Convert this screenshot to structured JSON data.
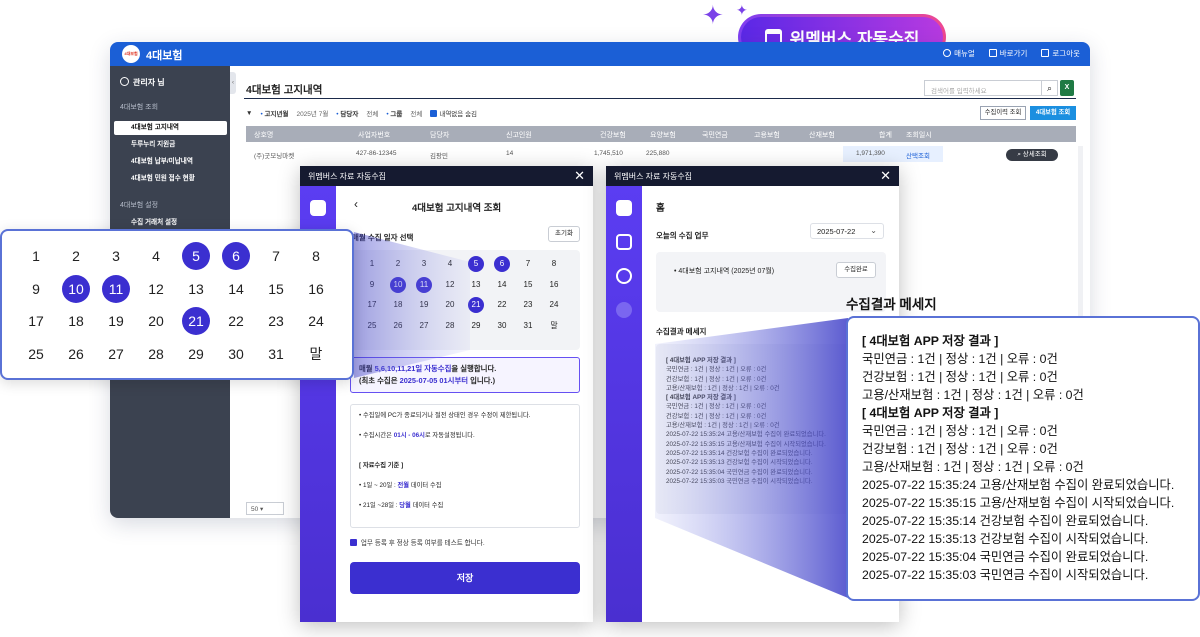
{
  "pill": {
    "label": "위멤버스 자동수집",
    "icon": "calendar-icon"
  },
  "app": {
    "title": "4대보험",
    "logo": "4대보험",
    "topbar": {
      "manual": "매뉴얼",
      "shortcut": "바로가기",
      "logout": "로그아웃"
    },
    "sidebar": {
      "user": "관리자 님",
      "section1": "4대보험 조회",
      "items": [
        "4대보험 고지내역",
        "두루누리 지원금",
        "4대보험 납부/미납내역",
        "4대보험 민원 접수 현황"
      ],
      "section2": "4대보험 설정",
      "item_setting": "수집 거래처 설정"
    },
    "page_title": "4대보험 고지내역",
    "search_placeholder": "검색어를 입력하세요",
    "excel": "X",
    "filter": {
      "notice_month_label": "고지년월",
      "notice_month_value": "2025년 7월",
      "manager_label": "담당자",
      "manager_value": "전체",
      "group_label": "그룹",
      "group_value": "전체",
      "hide_label": "내역없음 숨김"
    },
    "buttons": {
      "history": "수집이력 조회",
      "view": "4대보험 조회",
      "detail": "상세조회"
    },
    "columns": [
      "상호명",
      "사업자번호",
      "담당자",
      "신고인원",
      "건강보험",
      "요양보험",
      "국민연금",
      "고용보험",
      "산재보험",
      "합계",
      "조회일시"
    ],
    "row": {
      "company": "(주)굿모닝마켓",
      "bizno": "427-86-12345",
      "manager": "김팡민",
      "count": "14",
      "health": "1,745,510",
      "care": "225,880",
      "total": "1,971,390",
      "status": "산택조회"
    },
    "pager": "50"
  },
  "dialog1": {
    "bar_title": "위멤버스 자료 자동수집",
    "title": "4대보험 고지내역 조회",
    "date_label": "매월 수집 일자 선택",
    "reset": "초기화",
    "calendar": [
      "1",
      "2",
      "3",
      "4",
      "5",
      "6",
      "7",
      "8",
      "9",
      "10",
      "11",
      "12",
      "13",
      "14",
      "15",
      "16",
      "17",
      "18",
      "19",
      "20",
      "21",
      "22",
      "23",
      "24",
      "25",
      "26",
      "27",
      "28",
      "29",
      "30",
      "31",
      "말"
    ],
    "selected": [
      "5",
      "6",
      "10",
      "11",
      "21"
    ],
    "info_line1_a": "매월 ",
    "info_line1_b": "5,6,10,11,21일 자동수집",
    "info_line1_c": "을 실행합니다.",
    "info_line2_a": "(최초 수집은 ",
    "info_line2_b": "2025-07-05 01시부터",
    "info_line2_c": " 입니다.)",
    "note1": "수집일에 PC가 종료되거나 절전 상태인 경우 수정이 제한됩니다.",
    "note2_a": "수집시간은 ",
    "note2_b": "01시 - 06시",
    "note2_c": "로 자동설정됩니다.",
    "note_head": "[ 자료수집 기준 ]",
    "note3_a": "1일 ~ 20일 : ",
    "note3_b": "전월",
    "note3_c": " 데이터 수집",
    "note4_a": "21일 ~28일 : ",
    "note4_b": "당월",
    "note4_c": " 데이터 수집",
    "check_label": "업무 등록 후 정상 등록 여부를 테스트 합니다.",
    "save": "저장"
  },
  "dialog2": {
    "bar_title": "위멤버스 자료 자동수집",
    "home": "홈",
    "task_label": "오늘의 수집 업무",
    "date": "2025-07-22",
    "task_item": "4대보험 고지내역  (2025년 07월)",
    "done": "수집완료",
    "msg_label": "수집결과 메세지",
    "log": [
      "[ 4대보험 APP 저장 결과 ]",
      "국민연금 : 1건 | 정상 : 1건 | 오류 : 0건",
      "건강보험 : 1건 | 정상 : 1건 | 오류 : 0건",
      "고용/산재보험 : 1건 | 정상 : 1건 | 오류 : 0건",
      "[ 4대보험 APP 저장 결과 ]",
      "국민연금 : 1건 | 정상 : 1건 | 오류 : 0건",
      "건강보험 : 1건 | 정상 : 1건 | 오류 : 0건",
      "고용/산재보험 : 1건 | 정상 : 1건 | 오류 : 0건",
      "2025-07-22 15:35:24 고용/산재보험 수집이 완료되었습니다.",
      "2025-07-22 15:35:15 고용/산재보험 수집이 시작되었습니다.",
      "2025-07-22 15:35:14 건강보험 수집이 완료되었습니다.",
      "2025-07-22 15:35:13 건강보험 수집이 시작되었습니다.",
      "2025-07-22 15:35:04 국민연금 수집이 완료되었습니다.",
      "2025-07-22 15:35:03 국민연금 수집이 시작되었습니다."
    ]
  },
  "zoom": {
    "msg_title": "수집결과 메세지"
  },
  "colors": {
    "brand_blue": "#1b5fd6",
    "purple": "#3b2fd0",
    "callout_border": "#5a72d6"
  }
}
